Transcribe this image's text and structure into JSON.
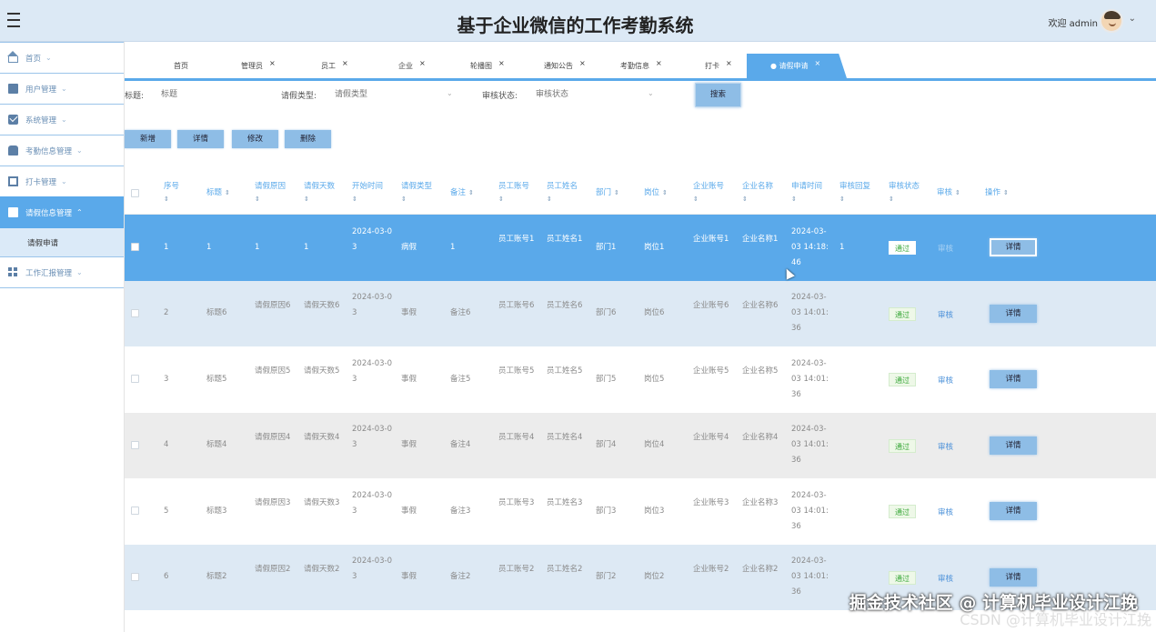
{
  "header": {
    "title": "基于企业微信的工作考勤系统",
    "welcome": "欢迎 admin",
    "caret": "⌄"
  },
  "sidebar": {
    "items": [
      {
        "label": "首页",
        "icon": "home-icon"
      },
      {
        "label": "用户管理",
        "icon": "user-icon"
      },
      {
        "label": "系统管理",
        "icon": "system-icon"
      },
      {
        "label": "考勤信息管理",
        "icon": "bus-icon"
      },
      {
        "label": "打卡管理",
        "icon": "card-icon"
      },
      {
        "label": "请假信息管理",
        "icon": "briefcase-icon",
        "active": true
      },
      {
        "label": "工作汇报管理",
        "icon": "grid-icon"
      }
    ],
    "sub_item": "请假申请"
  },
  "tabs": [
    {
      "label": "首页"
    },
    {
      "label": "管理员"
    },
    {
      "label": "员工"
    },
    {
      "label": "企业"
    },
    {
      "label": "轮播图"
    },
    {
      "label": "通知公告"
    },
    {
      "label": "考勤信息"
    },
    {
      "label": "打卡"
    },
    {
      "label": "● 请假申请",
      "active": true
    }
  ],
  "tab_close": "×",
  "search": {
    "title_label": "标题:",
    "title_placeholder": "标题",
    "type_label": "请假类型:",
    "type_placeholder": "请假类型",
    "status_label": "审核状态:",
    "status_placeholder": "审核状态",
    "button": "搜索"
  },
  "actions": {
    "add": "新增",
    "detail": "详情",
    "edit": "修改",
    "delete": "删除"
  },
  "table": {
    "headers": [
      "序号",
      "标题",
      "请假原因",
      "请假天数",
      "开始时间",
      "请假类型",
      "备注",
      "员工账号",
      "员工姓名",
      "部门",
      "岗位",
      "企业账号",
      "企业名称",
      "申请时间",
      "审核回复",
      "审核状态",
      "审核",
      "操作"
    ],
    "sort_glyph": "⇕",
    "rows": [
      {
        "no": "1",
        "title": "1",
        "reason": "1",
        "days": "1",
        "start": "2024-03-03",
        "type": "病假",
        "remark": "1",
        "acct": "员工账号1",
        "name": "员工姓名1",
        "dept": "部门1",
        "post": "岗位1",
        "corp": "企业账号1",
        "corpname": "企业名称1",
        "time": "2024-03-03 14:18:46",
        "reply": "1",
        "status": "通过",
        "audit": "审核",
        "op": "详情"
      },
      {
        "no": "2",
        "title": "标题6",
        "reason": "请假原因6",
        "days": "请假天数6",
        "start": "2024-03-03",
        "type": "事假",
        "remark": "备注6",
        "acct": "员工账号6",
        "name": "员工姓名6",
        "dept": "部门6",
        "post": "岗位6",
        "corp": "企业账号6",
        "corpname": "企业名称6",
        "time": "2024-03-03 14:01:36",
        "reply": "",
        "status": "通过",
        "audit": "审核",
        "op": "详情"
      },
      {
        "no": "3",
        "title": "标题5",
        "reason": "请假原因5",
        "days": "请假天数5",
        "start": "2024-03-03",
        "type": "事假",
        "remark": "备注5",
        "acct": "员工账号5",
        "name": "员工姓名5",
        "dept": "部门5",
        "post": "岗位5",
        "corp": "企业账号5",
        "corpname": "企业名称5",
        "time": "2024-03-03 14:01:36",
        "reply": "",
        "status": "通过",
        "audit": "审核",
        "op": "详情"
      },
      {
        "no": "4",
        "title": "标题4",
        "reason": "请假原因4",
        "days": "请假天数4",
        "start": "2024-03-03",
        "type": "事假",
        "remark": "备注4",
        "acct": "员工账号4",
        "name": "员工姓名4",
        "dept": "部门4",
        "post": "岗位4",
        "corp": "企业账号4",
        "corpname": "企业名称4",
        "time": "2024-03-03 14:01:36",
        "reply": "",
        "status": "通过",
        "audit": "审核",
        "op": "详情"
      },
      {
        "no": "5",
        "title": "标题3",
        "reason": "请假原因3",
        "days": "请假天数3",
        "start": "2024-03-03",
        "type": "事假",
        "remark": "备注3",
        "acct": "员工账号3",
        "name": "员工姓名3",
        "dept": "部门3",
        "post": "岗位3",
        "corp": "企业账号3",
        "corpname": "企业名称3",
        "time": "2024-03-03 14:01:36",
        "reply": "",
        "status": "通过",
        "audit": "审核",
        "op": "详情"
      },
      {
        "no": "6",
        "title": "标题2",
        "reason": "请假原因2",
        "days": "请假天数2",
        "start": "2024-03-03",
        "type": "事假",
        "remark": "备注2",
        "acct": "员工账号2",
        "name": "员工姓名2",
        "dept": "部门2",
        "post": "岗位2",
        "corp": "企业账号2",
        "corpname": "企业名称2",
        "time": "2024-03-03 14:01:36",
        "reply": "",
        "status": "通过",
        "audit": "审核",
        "op": "详情"
      }
    ]
  },
  "watermark": "掘金技术社区 @ 计算机毕业设计江挽",
  "watermark2": "CSDN @计算机毕业设计江挽"
}
